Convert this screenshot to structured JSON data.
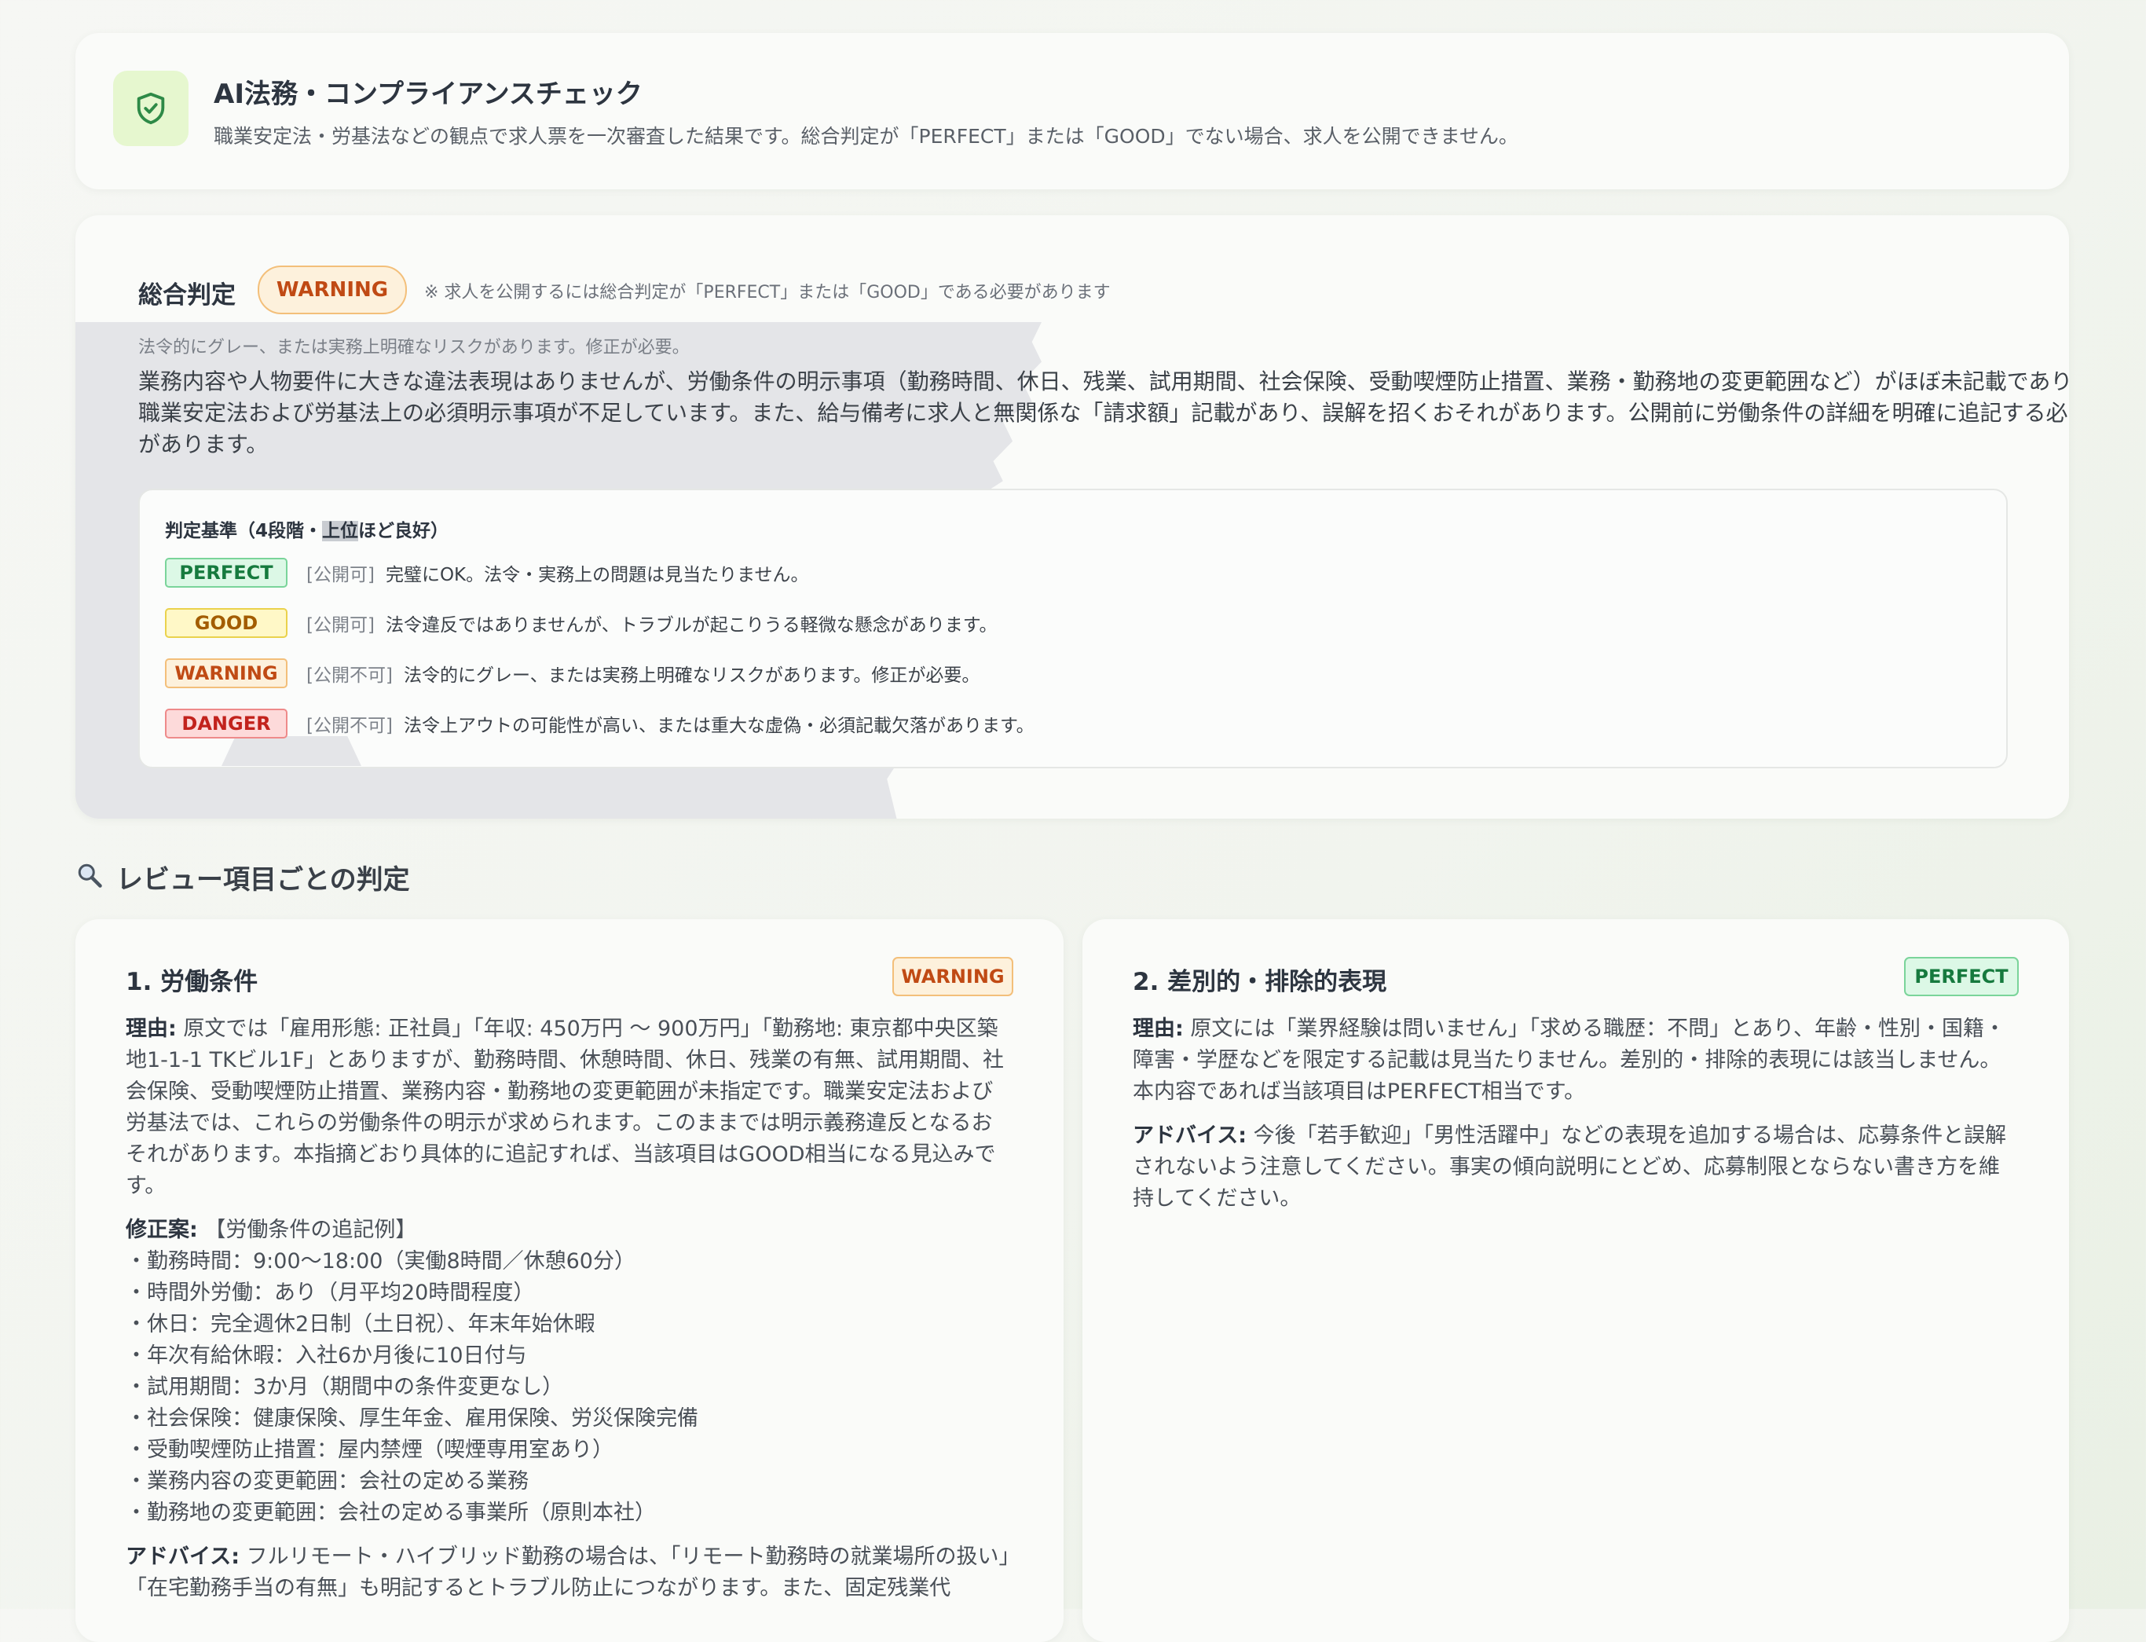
{
  "header": {
    "title": "AI法務・コンプライアンスチェック",
    "description": "職業安定法・労基法などの観点で求人票を一次審査した結果です。総合判定が「PERFECT」または「GOOD」でない場合、求人を公開できません。",
    "icon": "shield-check-icon"
  },
  "overall": {
    "label": "総合判定",
    "badge": "WARNING",
    "note": "※ 求人を公開するには総合判定が「PERFECT」または「GOOD」である必要があります",
    "subtitle": "法令的にグレー、または実務上明確なリスクがあります。修正が必要。",
    "body": "業務内容や人物要件に大きな違法表現はありませんが、労働条件の明示事項（勤務時間、休日、残業、試用期間、社会保険、受動喫煙防止措置、業務・勤務地の変更範囲など）がほぼ未記載であり、職業安定法および労基法上の必須明示事項が不足しています。また、給与備考に求人と無関係な「請求額」記載があり、誤解を招くおそれがあります。公開前に労働条件の詳細を明確に追記する必要があります。",
    "criteria": {
      "title_before": "判定基準（4段階・",
      "title_highlight": "上位",
      "title_after": "ほど良好）",
      "items": [
        {
          "badge": "PERFECT",
          "status": "[公開可]",
          "desc": "完璧にOK。法令・実務上の問題は見当たりません。"
        },
        {
          "badge": "GOOD",
          "status": "[公開可]",
          "desc": "法令違反ではありませんが、トラブルが起こりうる軽微な懸念があります。"
        },
        {
          "badge": "WARNING",
          "status": "[公開不可]",
          "desc": "法令的にグレー、または実務上明確なリスクがあります。修正が必要。"
        },
        {
          "badge": "DANGER",
          "status": "[公開不可]",
          "desc": "法令上アウトの可能性が高い、または重大な虚偽・必須記載欠落があります。"
        }
      ]
    }
  },
  "section": {
    "icon": "magnifier-icon",
    "title": "レビュー項目ごとの判定"
  },
  "reviews": [
    {
      "title": "1. 労働条件",
      "badge": "WARNING",
      "reason_label": "理由:",
      "reason": "原文では「雇用形態: 正社員」「年収: 450万円 〜 900万円」「勤務地: 東京都中央区築地1-1-1 TKビル1F」とありますが、勤務時間、休憩時間、休日、残業の有無、試用期間、社会保険、受動喫煙防止措置、業務内容・勤務地の変更範囲が未指定です。職業安定法および労基法では、これらの労働条件の明示が求められます。このままでは明示義務違反となるおそれがあります。本指摘どおり具体的に追記すれば、当該項目はGOOD相当になる見込みです。",
      "fix_label": "修正案:",
      "fix_intro": "【労働条件の追記例】",
      "fix_items": [
        "・勤務時間：9:00〜18:00（実働8時間／休憩60分）",
        "・時間外労働：あり（月平均20時間程度）",
        "・休日：完全週休2日制（土日祝）、年末年始休暇",
        "・年次有給休暇：入社6か月後に10日付与",
        "・試用期間：3か月（期間中の条件変更なし）",
        "・社会保険：健康保険、厚生年金、雇用保険、労災保険完備",
        "・受動喫煙防止措置：屋内禁煙（喫煙専用室あり）",
        "・業務内容の変更範囲：会社の定める業務",
        "・勤務地の変更範囲：会社の定める事業所（原則本社）"
      ],
      "advice_label": "アドバイス:",
      "advice": "フルリモート・ハイブリッド勤務の場合は、「リモート勤務時の就業場所の扱い」「在宅勤務手当の有無」も明記するとトラブル防止につながります。また、固定残業代"
    },
    {
      "title": "2. 差別的・排除的表現",
      "badge": "PERFECT",
      "reason_label": "理由:",
      "reason": "原文には「業界経験は問いません」「求める職歴：不問」とあり、年齢・性別・国籍・障害・学歴などを限定する記載は見当たりません。差別的・排除的表現には該当しません。本内容であれば当該項目はPERFECT相当です。",
      "advice_label": "アドバイス:",
      "advice": "今後「若手歓迎」「男性活躍中」などの表現を追加する場合は、応募条件と誤解されないよう注意してください。事実の傾向説明にとどめ、応募制限とならない書き方を維持してください。"
    }
  ]
}
